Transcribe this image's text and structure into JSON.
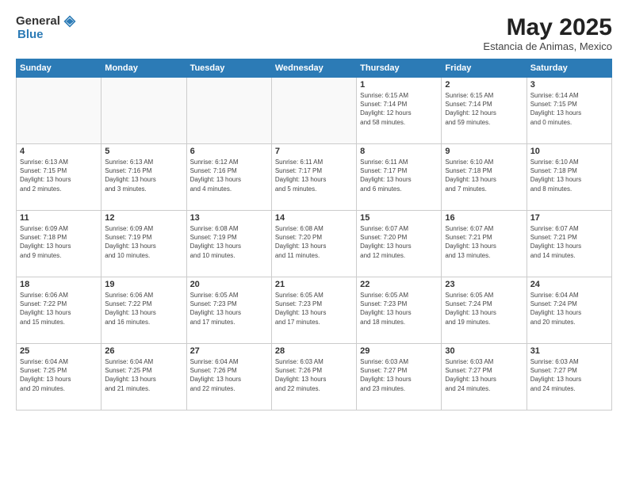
{
  "header": {
    "logo_general": "General",
    "logo_blue": "Blue",
    "month_title": "May 2025",
    "subtitle": "Estancia de Animas, Mexico"
  },
  "days_of_week": [
    "Sunday",
    "Monday",
    "Tuesday",
    "Wednesday",
    "Thursday",
    "Friday",
    "Saturday"
  ],
  "weeks": [
    [
      {
        "day": "",
        "info": ""
      },
      {
        "day": "",
        "info": ""
      },
      {
        "day": "",
        "info": ""
      },
      {
        "day": "",
        "info": ""
      },
      {
        "day": "1",
        "info": "Sunrise: 6:15 AM\nSunset: 7:14 PM\nDaylight: 12 hours\nand 58 minutes."
      },
      {
        "day": "2",
        "info": "Sunrise: 6:15 AM\nSunset: 7:14 PM\nDaylight: 12 hours\nand 59 minutes."
      },
      {
        "day": "3",
        "info": "Sunrise: 6:14 AM\nSunset: 7:15 PM\nDaylight: 13 hours\nand 0 minutes."
      }
    ],
    [
      {
        "day": "4",
        "info": "Sunrise: 6:13 AM\nSunset: 7:15 PM\nDaylight: 13 hours\nand 2 minutes."
      },
      {
        "day": "5",
        "info": "Sunrise: 6:13 AM\nSunset: 7:16 PM\nDaylight: 13 hours\nand 3 minutes."
      },
      {
        "day": "6",
        "info": "Sunrise: 6:12 AM\nSunset: 7:16 PM\nDaylight: 13 hours\nand 4 minutes."
      },
      {
        "day": "7",
        "info": "Sunrise: 6:11 AM\nSunset: 7:17 PM\nDaylight: 13 hours\nand 5 minutes."
      },
      {
        "day": "8",
        "info": "Sunrise: 6:11 AM\nSunset: 7:17 PM\nDaylight: 13 hours\nand 6 minutes."
      },
      {
        "day": "9",
        "info": "Sunrise: 6:10 AM\nSunset: 7:18 PM\nDaylight: 13 hours\nand 7 minutes."
      },
      {
        "day": "10",
        "info": "Sunrise: 6:10 AM\nSunset: 7:18 PM\nDaylight: 13 hours\nand 8 minutes."
      }
    ],
    [
      {
        "day": "11",
        "info": "Sunrise: 6:09 AM\nSunset: 7:18 PM\nDaylight: 13 hours\nand 9 minutes."
      },
      {
        "day": "12",
        "info": "Sunrise: 6:09 AM\nSunset: 7:19 PM\nDaylight: 13 hours\nand 10 minutes."
      },
      {
        "day": "13",
        "info": "Sunrise: 6:08 AM\nSunset: 7:19 PM\nDaylight: 13 hours\nand 10 minutes."
      },
      {
        "day": "14",
        "info": "Sunrise: 6:08 AM\nSunset: 7:20 PM\nDaylight: 13 hours\nand 11 minutes."
      },
      {
        "day": "15",
        "info": "Sunrise: 6:07 AM\nSunset: 7:20 PM\nDaylight: 13 hours\nand 12 minutes."
      },
      {
        "day": "16",
        "info": "Sunrise: 6:07 AM\nSunset: 7:21 PM\nDaylight: 13 hours\nand 13 minutes."
      },
      {
        "day": "17",
        "info": "Sunrise: 6:07 AM\nSunset: 7:21 PM\nDaylight: 13 hours\nand 14 minutes."
      }
    ],
    [
      {
        "day": "18",
        "info": "Sunrise: 6:06 AM\nSunset: 7:22 PM\nDaylight: 13 hours\nand 15 minutes."
      },
      {
        "day": "19",
        "info": "Sunrise: 6:06 AM\nSunset: 7:22 PM\nDaylight: 13 hours\nand 16 minutes."
      },
      {
        "day": "20",
        "info": "Sunrise: 6:05 AM\nSunset: 7:23 PM\nDaylight: 13 hours\nand 17 minutes."
      },
      {
        "day": "21",
        "info": "Sunrise: 6:05 AM\nSunset: 7:23 PM\nDaylight: 13 hours\nand 17 minutes."
      },
      {
        "day": "22",
        "info": "Sunrise: 6:05 AM\nSunset: 7:23 PM\nDaylight: 13 hours\nand 18 minutes."
      },
      {
        "day": "23",
        "info": "Sunrise: 6:05 AM\nSunset: 7:24 PM\nDaylight: 13 hours\nand 19 minutes."
      },
      {
        "day": "24",
        "info": "Sunrise: 6:04 AM\nSunset: 7:24 PM\nDaylight: 13 hours\nand 20 minutes."
      }
    ],
    [
      {
        "day": "25",
        "info": "Sunrise: 6:04 AM\nSunset: 7:25 PM\nDaylight: 13 hours\nand 20 minutes."
      },
      {
        "day": "26",
        "info": "Sunrise: 6:04 AM\nSunset: 7:25 PM\nDaylight: 13 hours\nand 21 minutes."
      },
      {
        "day": "27",
        "info": "Sunrise: 6:04 AM\nSunset: 7:26 PM\nDaylight: 13 hours\nand 22 minutes."
      },
      {
        "day": "28",
        "info": "Sunrise: 6:03 AM\nSunset: 7:26 PM\nDaylight: 13 hours\nand 22 minutes."
      },
      {
        "day": "29",
        "info": "Sunrise: 6:03 AM\nSunset: 7:27 PM\nDaylight: 13 hours\nand 23 minutes."
      },
      {
        "day": "30",
        "info": "Sunrise: 6:03 AM\nSunset: 7:27 PM\nDaylight: 13 hours\nand 24 minutes."
      },
      {
        "day": "31",
        "info": "Sunrise: 6:03 AM\nSunset: 7:27 PM\nDaylight: 13 hours\nand 24 minutes."
      }
    ]
  ]
}
